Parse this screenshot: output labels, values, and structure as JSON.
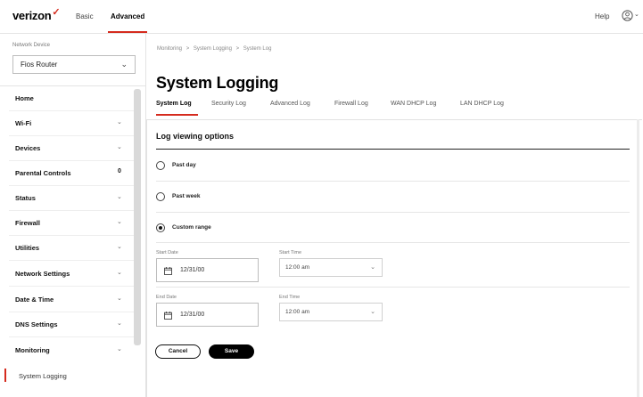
{
  "brand": {
    "logo_text": "verizon",
    "logo_mark": "✓",
    "accent": "#d52b1e"
  },
  "topnav": {
    "tabs": [
      "Basic",
      "Advanced"
    ],
    "active_tab": "Advanced",
    "help": "Help",
    "account_icon": "account-icon"
  },
  "sidebar": {
    "network_device_label": "Network Device",
    "network_device_value": "Fios Router",
    "items": [
      {
        "label": "Home",
        "indicator": ""
      },
      {
        "label": "Wi-Fi",
        "indicator": "⌄"
      },
      {
        "label": "Devices",
        "indicator": "⌄"
      },
      {
        "label": "Parental Controls",
        "indicator": "0"
      },
      {
        "label": "Status",
        "indicator": "⌄"
      },
      {
        "label": "Firewall",
        "indicator": "⌄"
      },
      {
        "label": "Utilities",
        "indicator": "⌄"
      },
      {
        "label": "Network Settings",
        "indicator": "⌄"
      },
      {
        "label": "Date & Time",
        "indicator": "⌄"
      },
      {
        "label": "DNS Settings",
        "indicator": "⌄"
      },
      {
        "label": "Monitoring",
        "indicator": "⌄"
      }
    ],
    "active_subitem": "System Logging"
  },
  "breadcrumb": [
    "Monitoring",
    ">",
    "System Logging",
    ">",
    "System Log"
  ],
  "page": {
    "title": "System Logging",
    "tabs": [
      "System Log",
      "Security Log",
      "Advanced Log",
      "Firewall Log",
      "WAN DHCP Log",
      "LAN DHCP Log"
    ],
    "active_tab": "System Log"
  },
  "log_options": {
    "title": "Log viewing options",
    "options": [
      {
        "label": "Past day",
        "checked": false
      },
      {
        "label": "Past week",
        "checked": false
      },
      {
        "label": "Custom range",
        "checked": true
      }
    ],
    "start_date_label": "Start Date",
    "start_date_value": "12/31/00",
    "start_time_label": "Start Time",
    "start_time_value": "12:00 am",
    "end_date_label": "End Date",
    "end_date_value": "12/31/00",
    "end_time_label": "End Time",
    "end_time_value": "12:00 am"
  },
  "actions": {
    "cancel": "Cancel",
    "save": "Save"
  }
}
